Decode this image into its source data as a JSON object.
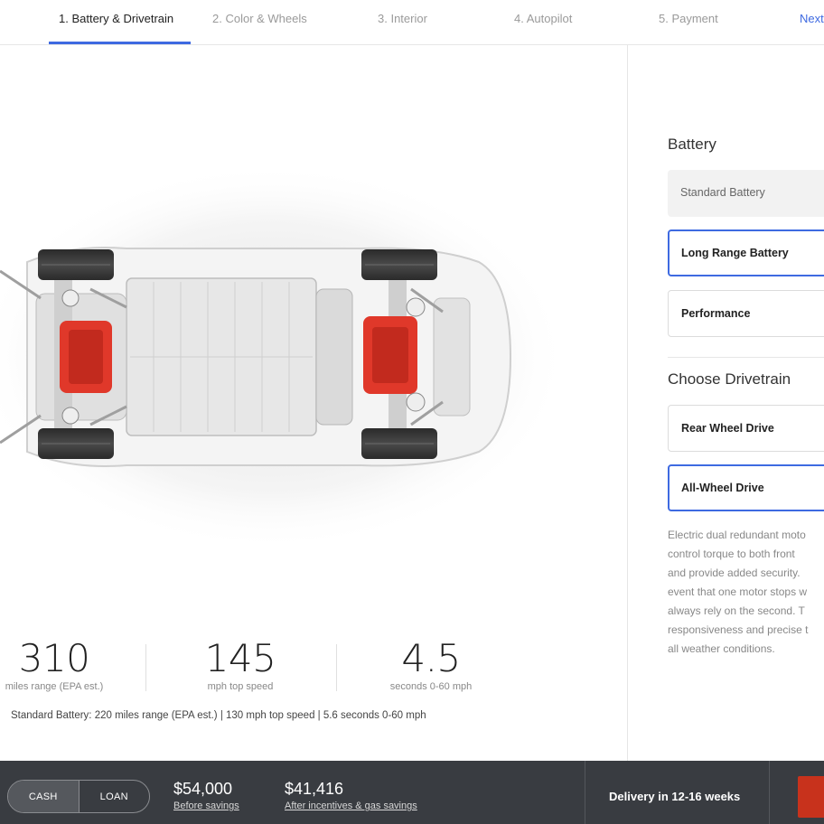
{
  "nav": {
    "steps": [
      {
        "label": "1. Battery & Drivetrain",
        "active": true
      },
      {
        "label": "2. Color & Wheels"
      },
      {
        "label": "3. Interior"
      },
      {
        "label": "4. Autopilot"
      },
      {
        "label": "5. Payment"
      }
    ],
    "next_label": "Next"
  },
  "stats": [
    {
      "value": "310",
      "label": "miles range (EPA est.)"
    },
    {
      "value": "145",
      "label": "mph top speed"
    },
    {
      "value": "4.5",
      "label": "seconds 0-60 mph"
    }
  ],
  "standard_note": "Standard Battery: 220 miles range (EPA est.) | 130 mph top speed | 5.6 seconds 0-60 mph",
  "battery": {
    "title": "Battery",
    "options": [
      {
        "label": "Standard Battery",
        "state": "disabled"
      },
      {
        "label": "Long Range Battery",
        "state": "selected"
      },
      {
        "label": "Performance",
        "state": "default"
      }
    ]
  },
  "drivetrain": {
    "title": "Choose Drivetrain",
    "options": [
      {
        "label": "Rear Wheel Drive",
        "state": "default"
      },
      {
        "label": "All-Wheel Drive",
        "state": "selected"
      }
    ],
    "description_lines": [
      "Electric dual redundant moto",
      "control torque to both front",
      "and provide added security.",
      "event that one motor stops w",
      "always rely on the second. T",
      "responsiveness and precise t",
      "all weather conditions."
    ]
  },
  "footer": {
    "payment_options": [
      "CASH",
      "LOAN"
    ],
    "active_payment": "CASH",
    "price_before": {
      "value": "$54,000",
      "label": "Before savings"
    },
    "price_after": {
      "value": "$41,416",
      "label": "After incentives & gas savings"
    },
    "delivery": "Delivery in 12-16 weeks"
  },
  "colors": {
    "accent": "#3e6ae1",
    "motor": "#e0382a",
    "bar": "#393c41",
    "order": "#c8321c"
  }
}
